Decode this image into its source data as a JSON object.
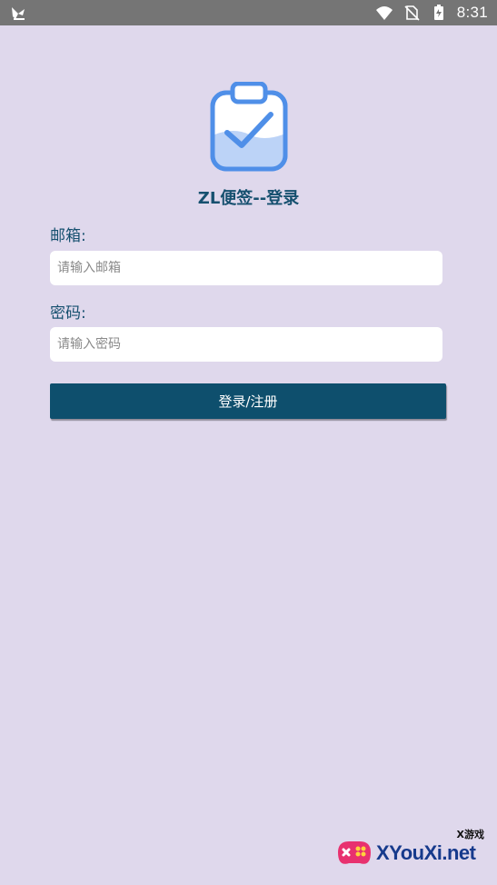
{
  "status_bar": {
    "time": "8:31",
    "icons": [
      "notification-app-icon",
      "wifi-icon",
      "no-sim-icon",
      "battery-charging-icon"
    ]
  },
  "app": {
    "title": "ZL便签--登录",
    "logo_icon": "clipboard-check-icon"
  },
  "form": {
    "email_label": "邮箱:",
    "email_placeholder": "请输入邮箱",
    "email_value": "",
    "password_label": "密码:",
    "password_placeholder": "请输入密码",
    "password_value": "",
    "submit_label": "登录/注册"
  },
  "watermark": {
    "small_text": "X游戏",
    "brand_text": "XYouXi.net",
    "icon": "gamepad-icon"
  },
  "colors": {
    "background": "#dfd8ec",
    "status_bar": "#757575",
    "primary_text": "#16506f",
    "button": "#0e4f6d",
    "logo_blue": "#4f8fe8"
  }
}
